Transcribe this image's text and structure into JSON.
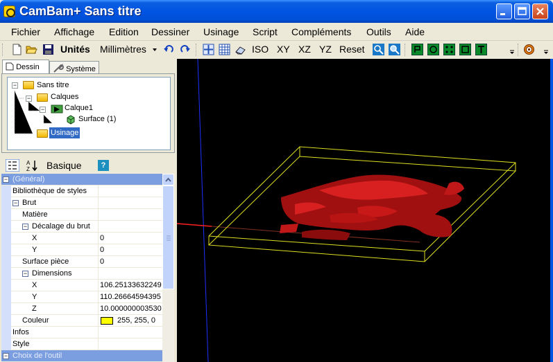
{
  "window": {
    "title": "CamBam+  Sans titre"
  },
  "menu": [
    "Fichier",
    "Affichage",
    "Edition",
    "Dessiner",
    "Usinage",
    "Script",
    "Compléments",
    "Outils",
    "Aide"
  ],
  "toolbar": {
    "units_label": "Unités",
    "units_value": "Millimètres",
    "view_iso": "ISO",
    "view_xy": "XY",
    "view_xz": "XZ",
    "view_yz": "YZ",
    "view_reset": "Reset"
  },
  "tabs": {
    "drawing": "Dessin",
    "system": "Système"
  },
  "tree": {
    "root": "Sans titre",
    "layers": "Calques",
    "layer1": "Calque1",
    "surface": "Surface (1)",
    "machining": "Usinage"
  },
  "props_toolbar": {
    "basic_label": "Basique",
    "help": "?"
  },
  "props": {
    "general": "(Général)",
    "style_library": "Bibliothèque de styles",
    "stock": "Brut",
    "material": "Matière",
    "stock_offset": "Décalage du brut",
    "offset_x": "X",
    "offset_x_val": "0",
    "offset_y": "Y",
    "offset_y_val": "0",
    "surface": "Surface pièce",
    "surface_val": "0",
    "dimensions": "Dimensions",
    "dim_x": "X",
    "dim_x_val": "106.25133632249",
    "dim_y": "Y",
    "dim_y_val": "110.26664594395",
    "dim_z": "Z",
    "dim_z_val": "10.000000003530",
    "color": "Couleur",
    "color_val": "255, 255, 0",
    "infos": "Infos",
    "style": "Style",
    "tool_choice": "Choix de l'outil"
  },
  "colors": {
    "stock_color": "#ffff00",
    "model_color": "#c00000",
    "selection": "#316ac5"
  }
}
